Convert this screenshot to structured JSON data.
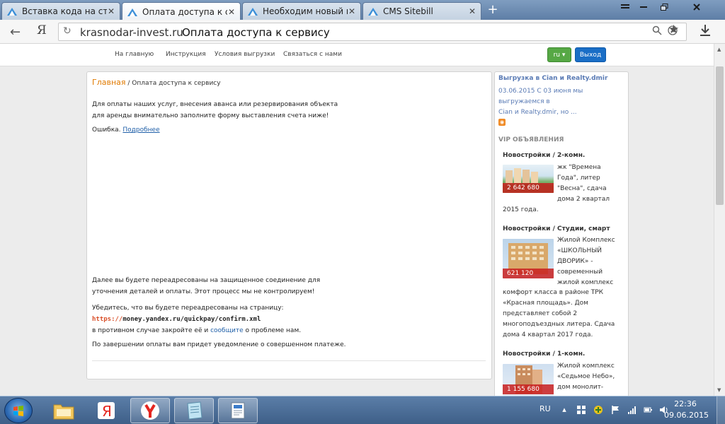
{
  "browser": {
    "tabs": [
      {
        "label": "Вставка кода на стра",
        "active": false
      },
      {
        "label": "Оплата доступа к серв",
        "active": true
      },
      {
        "label": "Необходим новый мо",
        "active": false
      },
      {
        "label": "CMS Sitebill",
        "active": false
      }
    ],
    "address": {
      "domain": "krasnodar-invest.ru",
      "page_title": "Оплата доступа к сервису"
    }
  },
  "site": {
    "nav": [
      "На главную",
      "Инструкция",
      "Условия выгрузки",
      "Связаться с нами"
    ],
    "lang_button": "ru ▾",
    "exit_button": "Выход"
  },
  "main": {
    "breadcrumb_home": "Главная",
    "breadcrumb_sep": " / ",
    "breadcrumb_current": "Оплата доступа к сервису",
    "intro_line1": "Для оплаты наших услуг, внесения аванса или резервирования объекта",
    "intro_line2": "для аренды внимательно заполните форму выставления счета ниже!",
    "error_label": "Ошибка.",
    "error_link": "Подробнее",
    "redirect_line1": "Далее вы будете переадресованы на защищенное соединение для",
    "redirect_line2": "уточнения деталей и оплаты. Этот процесс мы не контролируем!",
    "check_line": "Убедитесь, что вы будете переадресованы на страницу:",
    "url_scheme": "https://",
    "url_rest": "money.yandex.ru/quickpay/confirm.xml",
    "else_prefix": "в противном случае закройте её и ",
    "else_link": "сообщите",
    "else_suffix": " о проблеме нам.",
    "finish_line": "По завершении оплаты вам придет уведомление о совершенном платеже."
  },
  "sidebar": {
    "news_title": "Выгрузка в Cian и Realty.dmir",
    "news_date": "03.06.2015",
    "news_text_1": " С 03 июня мы выгружаемся в",
    "news_text_2": "Cian и Realty.dmir, но ...",
    "vip_title": "VIP ОБЪЯВЛЕНИЯ",
    "listings": [
      {
        "category": "Новостройки / 2-комн.",
        "price": "2 642 680",
        "desc": [
          "жк \"Времена",
          "Года\", литер",
          "\"Весна\", сдача",
          "дома 2 квартал"
        ],
        "desc_full": [
          "2015 года."
        ]
      },
      {
        "category": "Новостройки / Студии, смарт",
        "price": "621 120",
        "desc": [
          "Жилой Комплекс",
          "«ШКОЛЬНЫЙ",
          "ДВОРИК» -",
          "современный",
          "жилой комплекс"
        ],
        "desc_full": [
          "комфорт класса в районе ТРК",
          "«Красная площадь». Дом",
          "представляет собой 2",
          "многоподъездных литера. Сдача",
          "дома 4 квартал 2017 года."
        ]
      },
      {
        "category": "Новостройки / 1-комн.",
        "price": "1 155 680",
        "desc": [
          "Жилой комплекс",
          "«Седьмое Небо»,",
          "дом монолит-"
        ],
        "desc_full": []
      }
    ]
  },
  "taskbar": {
    "lang": "RU",
    "time": "22:36",
    "date": "09.06.2015"
  }
}
